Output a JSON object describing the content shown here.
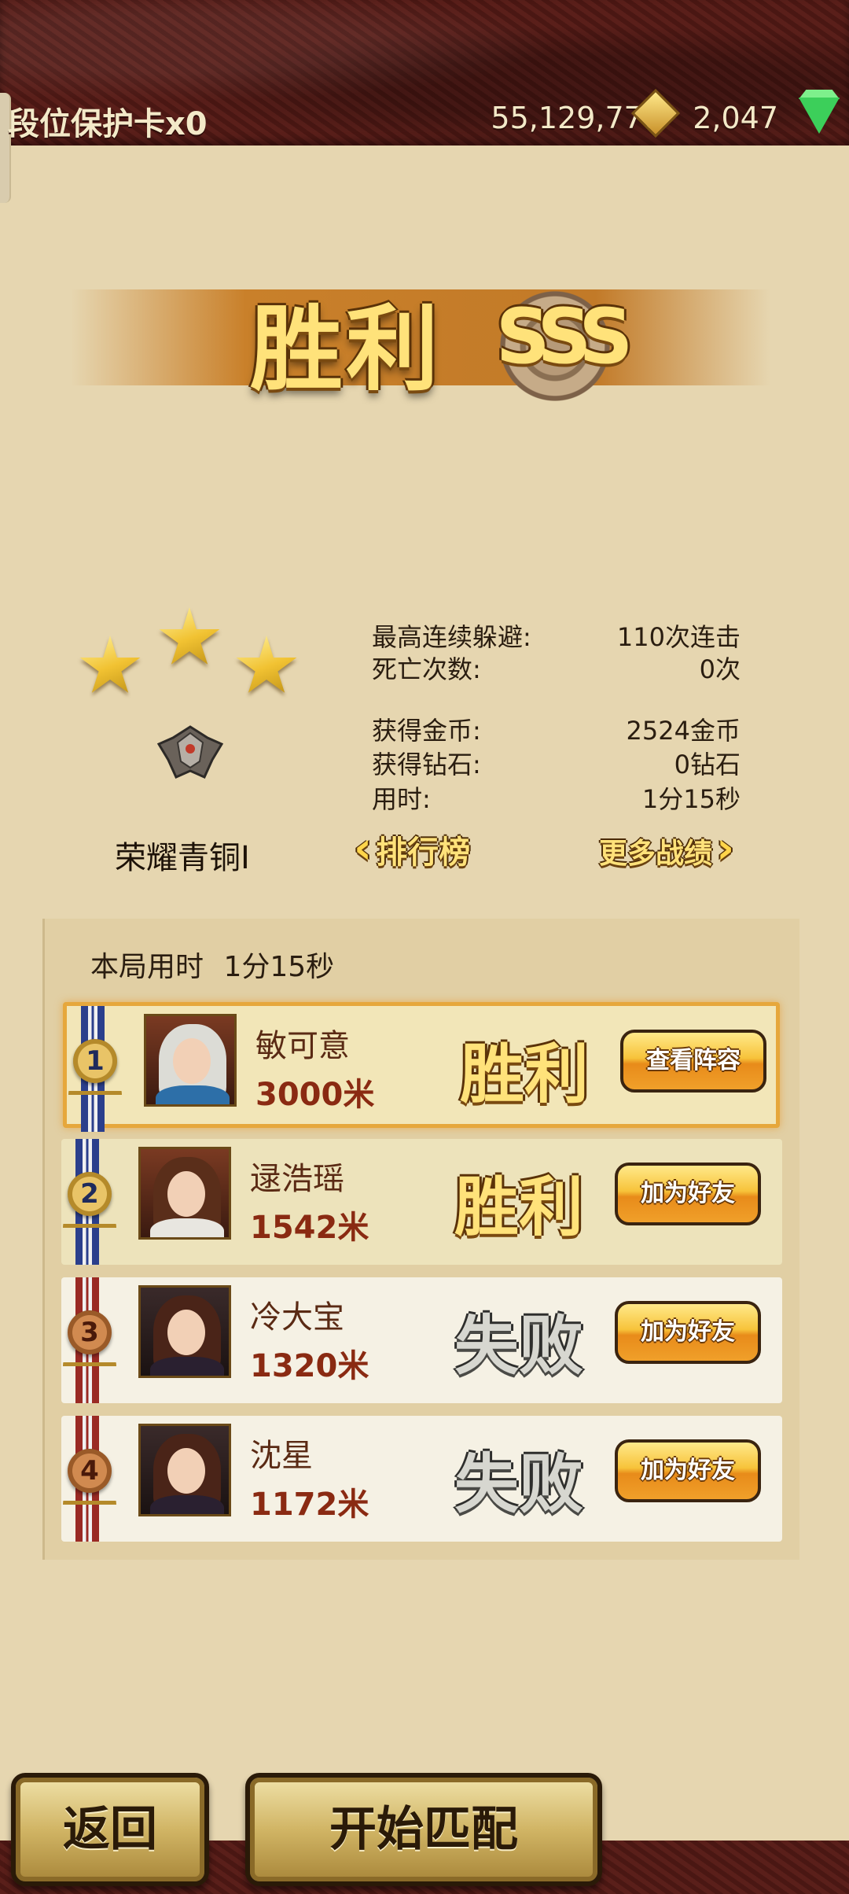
{
  "header": {
    "protection_card": "段位保护卡x0",
    "gold": "55,129,771",
    "diamonds": "2,047",
    "gold_icon": "gold-diamond-icon",
    "diamond_icon": "green-gem-icon"
  },
  "result": {
    "title": "胜利",
    "grade": "SSS",
    "stars": 3
  },
  "rank": {
    "label": "荣耀青铜I",
    "emblem_icon": "bronze-rank-emblem-icon"
  },
  "stats": [
    {
      "label": "最高连续躲避:",
      "value": "110次连击"
    },
    {
      "label": "死亡次数:",
      "value": "0次"
    },
    {
      "label": "获得金币:",
      "value": "2524金币"
    },
    {
      "label": "获得钻石:",
      "value": "0钻石"
    },
    {
      "label": "用时:",
      "value": "1分15秒"
    }
  ],
  "links": {
    "leaderboard": "排行榜",
    "more_records": "更多战绩"
  },
  "round": {
    "time_label": "本局用时",
    "time_value": "1分15秒"
  },
  "players": [
    {
      "rank": "1",
      "name": "敏可意",
      "distance": "3000米",
      "result": "胜利",
      "action": "查看阵容"
    },
    {
      "rank": "2",
      "name": "逯浩瑶",
      "distance": "1542米",
      "result": "胜利",
      "action": "加为好友"
    },
    {
      "rank": "3",
      "name": "冷大宝",
      "distance": "1320米",
      "result": "失败",
      "action": "加为好友"
    },
    {
      "rank": "4",
      "name": "沈星",
      "distance": "1172米",
      "result": "失败",
      "action": "加为好友"
    }
  ],
  "buttons": {
    "back": "返回",
    "start_match": "开始匹配"
  },
  "colors": {
    "background": "#e6d6b0",
    "leather": "#5a1f1a",
    "gold_text": "#ffe27a",
    "button_orange": "#f7c33a"
  }
}
